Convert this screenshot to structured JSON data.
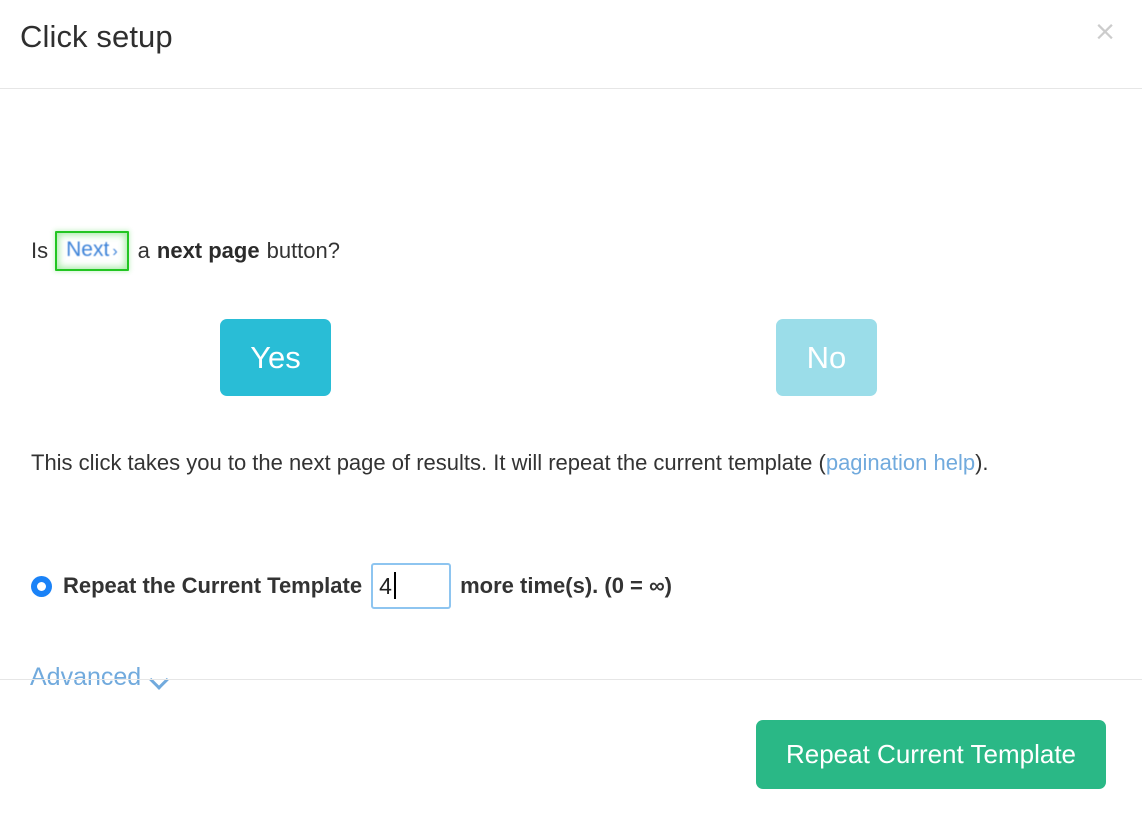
{
  "header": {
    "title": "Click setup",
    "close_label": "×"
  },
  "question": {
    "prefix": "Is",
    "target_text": "Next",
    "target_caret": "›",
    "middle": "a",
    "bold": "next page",
    "suffix": "button?"
  },
  "choices": {
    "yes_label": "Yes",
    "no_label": "No",
    "selected": "Yes",
    "yes_color": "#29bdd6",
    "no_color": "#9bdde9"
  },
  "description": {
    "part1": "This click takes you to the next page of results. It will repeat the current template (",
    "link": "pagination help",
    "part2": ")."
  },
  "repeat": {
    "radio_checked": true,
    "label": "Repeat the Current Template",
    "count_value": "4",
    "count_placeholder": "",
    "suffix": "more time(s). (0 = ∞)"
  },
  "advanced": {
    "label": "Advanced",
    "icon": "chevron-down-icon"
  },
  "footer": {
    "primary_label": "Repeat Current Template",
    "primary_color": "#2ab886"
  },
  "colors": {
    "link": "#71aadd",
    "highlight_border": "#22c522",
    "radio": "#1a82f7",
    "input_border": "#8ec5f0",
    "divider": "#e6e6e6"
  }
}
